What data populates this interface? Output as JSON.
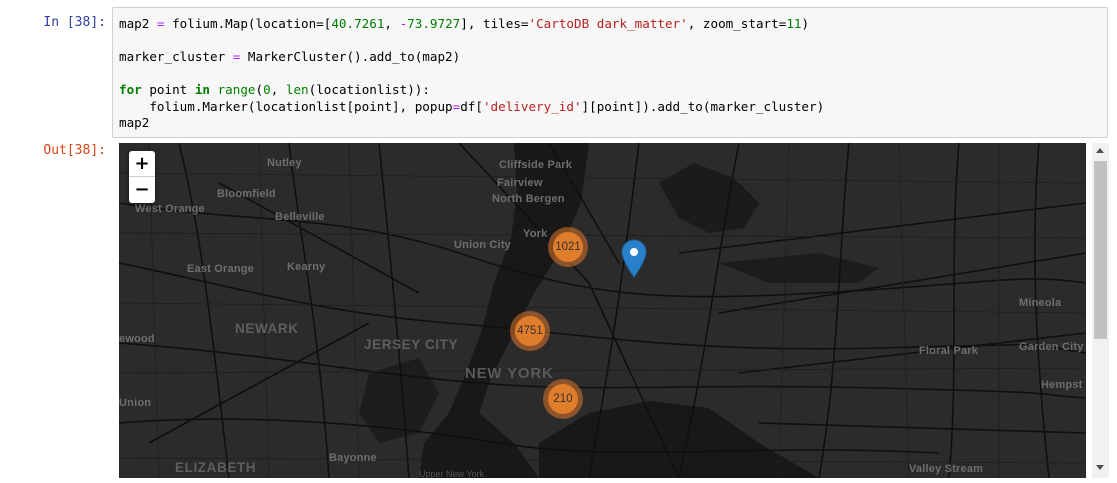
{
  "input_prompt": "In [38]:",
  "output_prompt": "Out[38]:",
  "code": {
    "line1": {
      "a": "map2 ",
      "op1": "=",
      "b": " folium.Map(location=[",
      "n1": "40.7261",
      "c": ", ",
      "op2": "-",
      "n2": "73.9727",
      "d": "], tiles=",
      "s1": "'CartoDB dark_matter'",
      "e": ", zoom_start=",
      "n3": "11",
      "f": ")"
    },
    "line3": {
      "a": "marker_cluster ",
      "op1": "=",
      "b": " MarkerCluster().add_to(map2)"
    },
    "line5": {
      "kw1": "for",
      "a": " point ",
      "kw2": "in",
      "sp": " ",
      "bi1": "range",
      "b": "(",
      "n1": "0",
      "c": ", ",
      "bi2": "len",
      "d": "(locationlist)):"
    },
    "line6": {
      "a": "    folium.Marker(locationlist[point], popup",
      "op1": "=",
      "b": "df[",
      "s1": "'delivery_id'",
      "c": "][point]).add_to(marker_cluster)"
    },
    "line7": "map2"
  },
  "map": {
    "zoom_in": "+",
    "zoom_out": "−",
    "labels": {
      "nutley": "Nutley",
      "cliffside_park": "Cliffside Park",
      "bloomfield": "Bloomfield",
      "fairview": "Fairview",
      "west_orange": "West Orange",
      "north_bergen": "North Bergen",
      "belleville": "Belleville",
      "york": "York",
      "union_city": "Union City",
      "east_orange": "East Orange",
      "kearny": "Kearny",
      "newark": "NEWARK",
      "mineola": "Mineola",
      "jersey_city": "JERSEY CITY",
      "ewood": "ewood",
      "floral_park": "Floral Park",
      "garden_city": "Garden City",
      "new_york": "NEW YORK",
      "hempst": "Hempst",
      "union": "Union",
      "elizabeth": "ELIZABETH",
      "bayonne": "Bayonne",
      "valley_stream": "Valley Stream"
    },
    "clusters": [
      {
        "id": "c1021",
        "count": "1021"
      },
      {
        "id": "c4751",
        "count": "4751"
      },
      {
        "id": "c210",
        "count": "210"
      }
    ],
    "attribution": "Upper New York",
    "colors": {
      "background": "#262626",
      "cluster": "#df7d2b",
      "marker": "#2a81cb"
    }
  }
}
